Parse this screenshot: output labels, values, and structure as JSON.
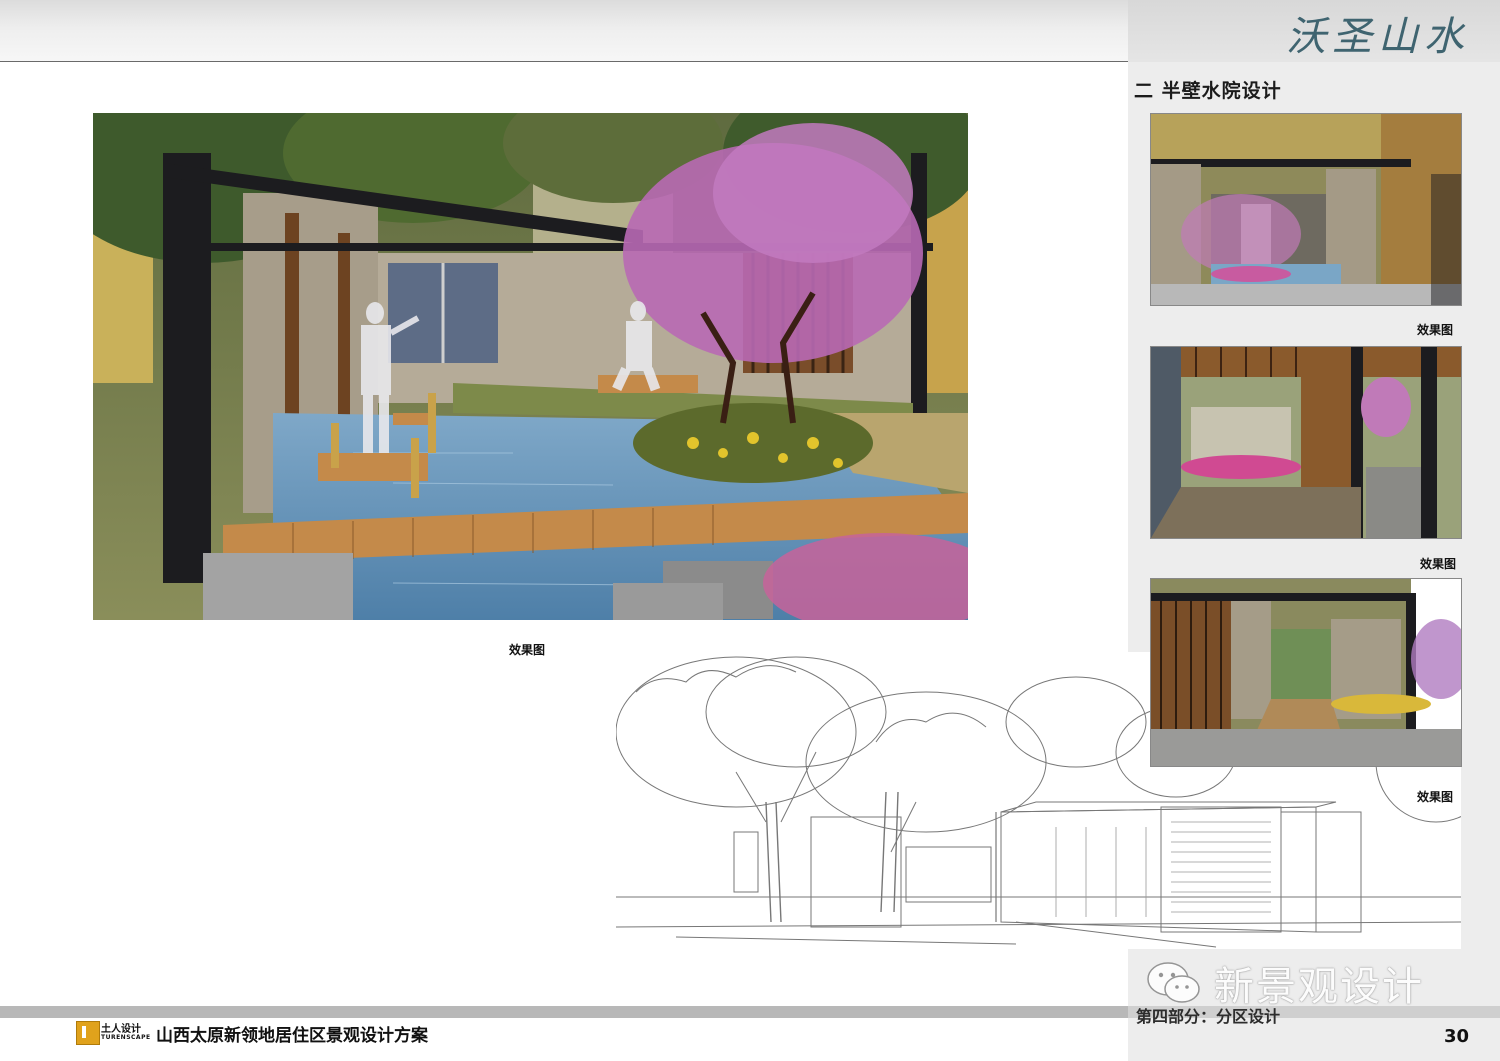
{
  "header": {
    "logo_calligraphy": "沃圣山水"
  },
  "sidebar": {
    "section_title": "二  半壁水院设计",
    "thumbnails": [
      {
        "caption": "效果图"
      },
      {
        "caption": "效果图"
      },
      {
        "caption": "效果图"
      }
    ]
  },
  "main": {
    "render_caption": "效果图"
  },
  "footer": {
    "brand_cn": "土人设计",
    "brand_en": "TURENSCAPE",
    "project_title": "山西太原新领地居住区景观设计方案",
    "chapter": "第四部分：分区设计",
    "page_number": "30"
  },
  "watermark": {
    "text": "新景观设计"
  }
}
